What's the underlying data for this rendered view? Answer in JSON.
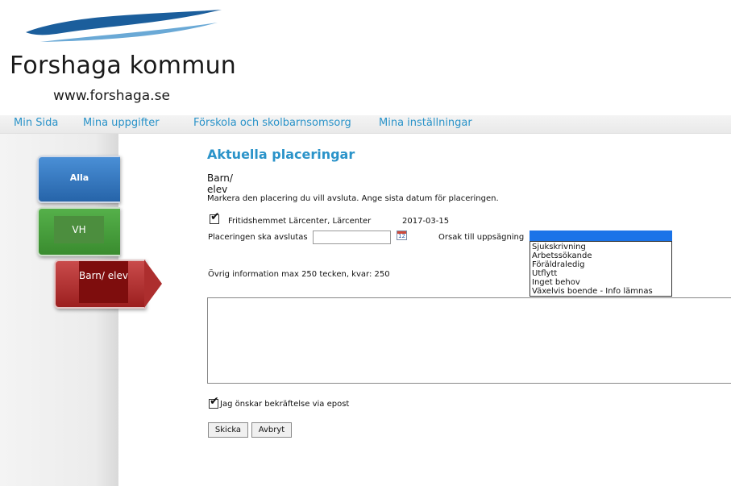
{
  "logo": {
    "name": "Forshaga kommun",
    "url": "www.forshaga.se",
    "wave_color": "#1b5e9c"
  },
  "topnav": {
    "items": [
      {
        "label": "Min Sida"
      },
      {
        "label": "Mina uppgifter"
      },
      {
        "label": "Förskola och skolbarnsomsorg"
      },
      {
        "label": "Mina inställningar"
      }
    ],
    "link_color": "#2a93c9"
  },
  "sidebar": {
    "tabs": [
      {
        "label": "Alla",
        "color": "#2a6fbf"
      },
      {
        "label": "VH",
        "color": "#4a9e3e"
      },
      {
        "label": "Barn/ elev",
        "color": "#a52525"
      }
    ]
  },
  "main": {
    "title": "Aktuella placeringar",
    "subtitle": "Barn/ elev",
    "instruction": "Markera den placering du vill avsluta. Ange sista datum för placeringen.",
    "placement": {
      "checked": true,
      "name": "Fritidshemmet Lärcenter, Lärcenter",
      "date": "2017-03-15"
    },
    "end_label": "Placeringen ska avslutas",
    "end_date_value": "",
    "calendar_icon": "calendar-icon",
    "reason_label": "Orsak till uppsägning",
    "reason_selected": "",
    "reason_options": [
      "Sjukskrivning",
      "Arbetssökande",
      "Föräldraledig",
      "Utflytt",
      "Inget behov",
      "Växelvis boende - Info lämnas"
    ],
    "other_info_label": "Övrig information max 250 tecken, kvar: 250",
    "other_info_value": "",
    "email_confirm_checked": true,
    "email_confirm_label": "Jag önskar bekräftelse via epost",
    "send_label": "Skicka",
    "cancel_label": "Avbryt"
  }
}
